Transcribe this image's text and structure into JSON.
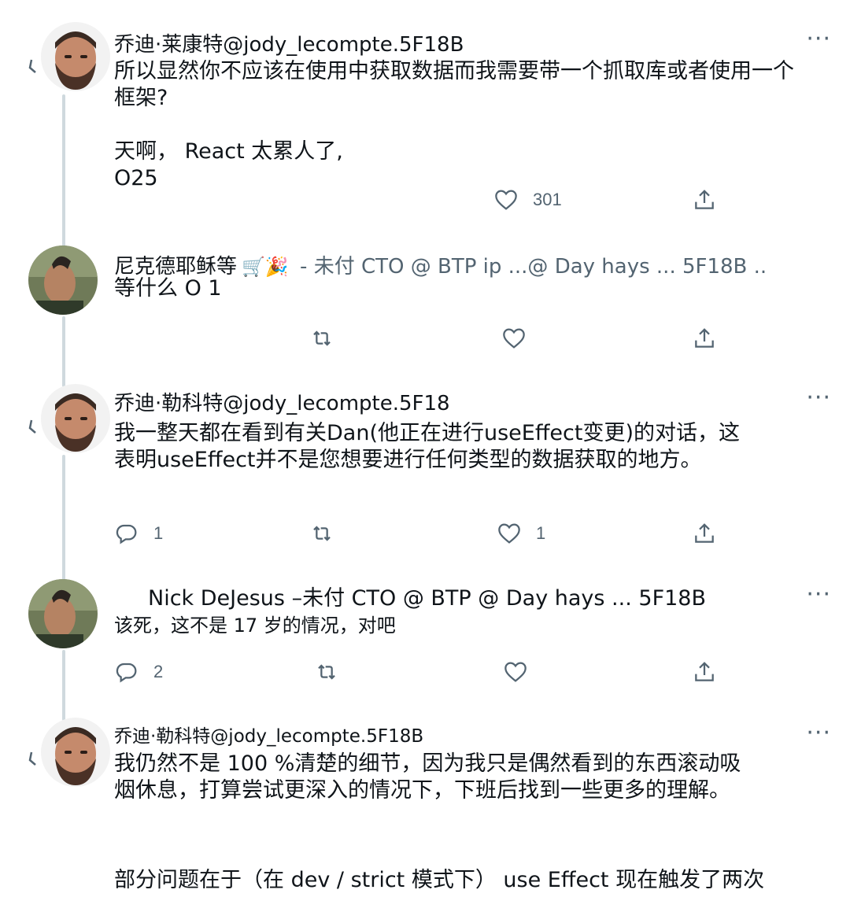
{
  "icons": {
    "reply": "reply-icon",
    "retweet": "retweet-icon",
    "like": "like-icon",
    "share": "share-icon",
    "more": "more-options-icon"
  },
  "colors": {
    "text": "#0f1419",
    "secondary": "#536471",
    "thread_line": "#cfd9de"
  },
  "tweets": [
    {
      "header_name": "乔迪·莱康特@jody_lecompte.5F18B",
      "more": "···",
      "body": [
        "所以显然你不应该在使用中获取数据而我需要带一个抓取库或者使用一个",
        "框架?",
        "",
        "天啊， React 太累人了,",
        "O25"
      ],
      "likes": "301"
    },
    {
      "header_name": "尼克德耶稣等",
      "header_emoji": "🛒🎉",
      "header_rest": " -    未付 CTO @ BTP ip ...@ Day hays ... 5F18B ..",
      "body": [
        "等什么 O 1"
      ]
    },
    {
      "header_name": "乔迪·勒科特@jody_lecompte.5F18",
      "more": "···",
      "body": [
        "我一整天都在看到有关Dan(他正在进行useEffect变更)的对话，这",
        "表明useEffect并不是您想要进行任何类型的数据获取的地方。"
      ],
      "replies": "1",
      "likes": "1"
    },
    {
      "header_name": "Nick DeJesus –未付 CTO @ BTP @ Day hays ... 5F18B",
      "more": "···",
      "body": [
        "该死，这不是 17 岁的情况，对吧"
      ],
      "replies": "2"
    },
    {
      "header_name": "乔迪·勒科特@jody_lecompte.5F18B",
      "more": "···",
      "body": [
        "我仍然不是 100 %清楚的细节，因为我只是偶然看到的东西滚动吸",
        "烟休息，打算尝试更深入的情况下，下班后找到一些更多的理解。",
        "",
        "",
        "部分问题在于（在 dev / strict 模式下） use Effect 现在触发了两次"
      ]
    }
  ]
}
